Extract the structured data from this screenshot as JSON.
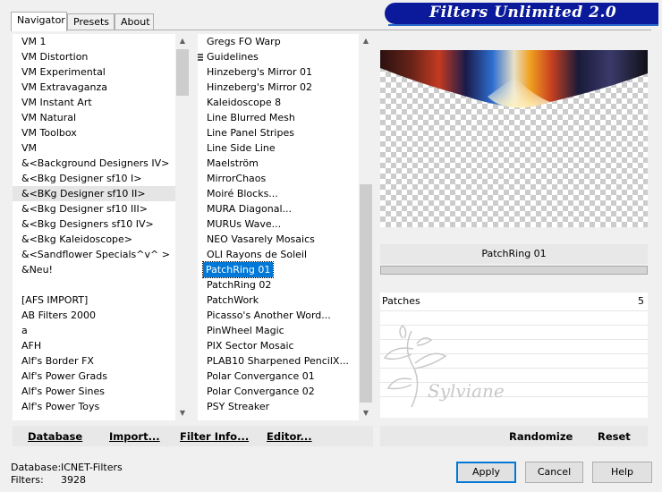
{
  "tabs": [
    {
      "label": "Navigator"
    },
    {
      "label": "Presets"
    },
    {
      "label": "About"
    }
  ],
  "banner": {
    "title": "Filters Unlimited 2.0"
  },
  "categories": {
    "items": [
      "VM 1",
      "VM Distortion",
      "VM Experimental",
      "VM Extravaganza",
      "VM Instant Art",
      "VM Natural",
      "VM Toolbox",
      "VM",
      "&<Background Designers IV>",
      "&<Bkg Designer sf10 I>",
      "&<BKg Designer sf10 II>",
      "&<Bkg Designer sf10 III>",
      "&<Bkg Designers sf10 IV>",
      "&<Bkg Kaleidoscope>",
      "&<Sandflower Specials^v^ >",
      "&Neu!",
      "",
      "[AFS IMPORT]",
      "AB Filters 2000",
      "a",
      "AFH",
      "Alf's Border FX",
      "Alf's Power Grads",
      "Alf's Power Sines",
      "Alf's Power Toys"
    ],
    "selected_index": 10
  },
  "filters": {
    "items": [
      "Gregs FO Warp",
      "Guidelines",
      "Hinzeberg's Mirror 01",
      "Hinzeberg's Mirror 02",
      "Kaleidoscope 8",
      "Line Blurred Mesh",
      "Line Panel Stripes",
      "Line Side Line",
      "Maelström",
      "MirrorChaos",
      "Moiré Blocks...",
      "MURA Diagonal...",
      "MURUs Wave...",
      "NEO Vasarely Mosaics",
      "OLI Rayons de Soleil",
      "PatchRing 01",
      "PatchRing 02",
      "PatchWork",
      "Picasso's Another Word...",
      "PinWheel Magic",
      "PIX Sector Mosaic",
      "PLAB10 Sharpened PencilX...",
      "Polar Convergance 01",
      "Polar Convergance 02",
      "PSY Streaker"
    ],
    "selected_index": 15
  },
  "filter_panel": {
    "name": "PatchRing 01",
    "param_name": "Patches",
    "param_value": "5"
  },
  "watermark_text": "Sylviane",
  "links": {
    "database": "Database",
    "import": "Import...",
    "filter_info": "Filter Info...",
    "editor": "Editor...",
    "randomize": "Randomize",
    "reset": "Reset"
  },
  "info": {
    "database_label": "Database:",
    "database_value": "ICNET-Filters",
    "filters_label": "Filters:",
    "filters_value": "3928"
  },
  "buttons": {
    "apply": "Apply",
    "cancel": "Cancel",
    "help": "Help"
  },
  "colors": {
    "banner": "#0a1a9a",
    "selection": "#0078d7"
  }
}
